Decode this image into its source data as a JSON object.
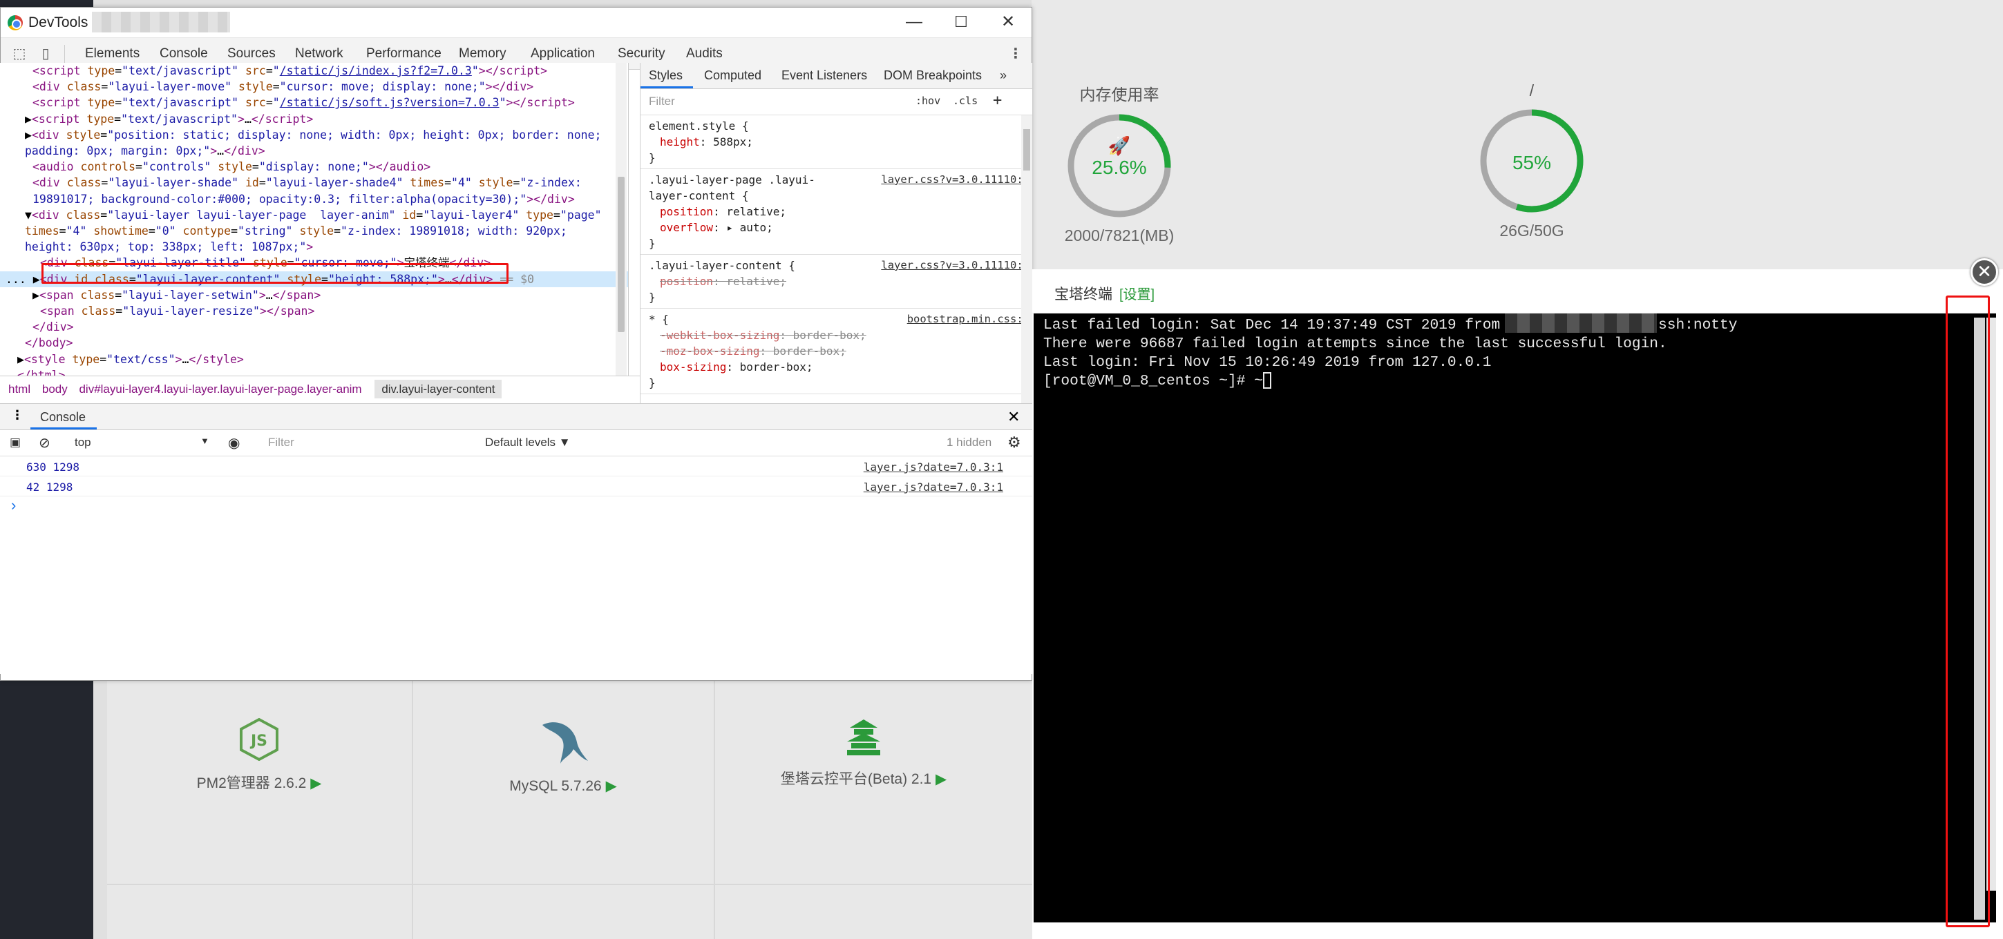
{
  "background": {
    "gauges": [
      {
        "title": "内存使用率",
        "value": "25.6%",
        "percent": 25.6,
        "sub": "2000/7821(MB)",
        "color": "#20a53a"
      },
      {
        "title": "/",
        "value": "55%",
        "percent": 55,
        "sub": "26G/50G",
        "color": "#20a53a"
      }
    ],
    "software": [
      {
        "label": "PM2管理器 2.6.2",
        "icon": "nodejs-icon"
      },
      {
        "label": "MySQL 5.7.26",
        "icon": "mysql-dolphin-icon"
      },
      {
        "label": "堡塔云控平台(Beta) 2.1",
        "icon": "pagoda-icon"
      }
    ]
  },
  "devtools": {
    "title": "DevTools",
    "window_buttons": {
      "minimize": "—",
      "maximize": "☐",
      "close": "✕"
    },
    "tabs": [
      "Elements",
      "Console",
      "Sources",
      "Network",
      "Performance",
      "Memory",
      "Application",
      "Security",
      "Audits"
    ],
    "active_tab": "Elements",
    "elements_lines": [
      {
        "indent": 3,
        "html": "<span class='tg'>&lt;script</span> <span class='at'>type</span>=<span class='av'>\"text/javascript\"</span> <span class='at'>src</span>=<span class='av'>\"<span class='lk'>/static/js/index.js?f2=7.0.3</span>\"</span><span class='tg'>&gt;&lt;/script&gt;</span>"
      },
      {
        "indent": 3,
        "html": "<span class='tg'>&lt;div</span> <span class='at'>class</span>=<span class='av'>\"layui-layer-move\"</span> <span class='at'>style</span>=<span class='av'>\"cursor: move; display: none;\"</span><span class='tg'>&gt;&lt;/div&gt;</span>"
      },
      {
        "indent": 3,
        "html": "<span class='tg'>&lt;script</span> <span class='at'>type</span>=<span class='av'>\"text/javascript\"</span> <span class='at'>src</span>=<span class='av'>\"<span class='lk'>/static/js/soft.js?version=7.0.3</span>\"</span><span class='tg'>&gt;&lt;/script&gt;</span>"
      },
      {
        "indent": 2,
        "html": "▶<span class='tg'>&lt;script</span> <span class='at'>type</span>=<span class='av'>\"text/javascript\"</span><span class='tg'>&gt;</span>…<span class='tg'>&lt;/script&gt;</span>"
      },
      {
        "indent": 2,
        "html": "▶<span class='tg'>&lt;div</span> <span class='at'>style</span>=<span class='av'>\"position: static; display: none; width: 0px; height: 0px; border: none;</span>"
      },
      {
        "indent": 2,
        "html": "<span class='av'>padding: 0px; margin: 0px;\"</span><span class='tg'>&gt;</span>…<span class='tg'>&lt;/div&gt;</span>"
      },
      {
        "indent": 3,
        "html": "<span class='tg'>&lt;audio</span> <span class='at'>controls</span>=<span class='av'>\"controls\"</span> <span class='at'>style</span>=<span class='av'>\"display: none;\"</span><span class='tg'>&gt;&lt;/audio&gt;</span>"
      },
      {
        "indent": 3,
        "html": "<span class='tg'>&lt;div</span> <span class='at'>class</span>=<span class='av'>\"layui-layer-shade\"</span> <span class='at'>id</span>=<span class='av'>\"layui-layer-shade4\"</span> <span class='at'>times</span>=<span class='av'>\"4\"</span> <span class='at'>style</span>=<span class='av'>\"z-index:</span>"
      },
      {
        "indent": 3,
        "html": "<span class='av'>19891017; background-color:#000; opacity:0.3; filter:alpha(opacity=30);\"</span><span class='tg'>&gt;&lt;/div&gt;</span>"
      },
      {
        "indent": 2,
        "html": "▼<span class='tg'>&lt;div</span> <span class='at'>class</span>=<span class='av'>\"layui-layer layui-layer-page  layer-anim\"</span> <span class='at'>id</span>=<span class='av'>\"layui-layer4\"</span> <span class='at'>type</span>=<span class='av'>\"page\"</span>"
      },
      {
        "indent": 2,
        "html": "<span class='at'>times</span>=<span class='av'>\"4\"</span> <span class='at'>showtime</span>=<span class='av'>\"0\"</span> <span class='at'>contype</span>=<span class='av'>\"string\"</span> <span class='at'>style</span>=<span class='av'>\"z-index: 19891018; width: 920px;</span>"
      },
      {
        "indent": 2,
        "html": "<span class='av'>height: 630px; top: 338px; left: 1087px;\"</span><span class='tg'>&gt;</span>"
      },
      {
        "indent": 4,
        "html": "<span class='tg'>&lt;div</span> <span class='at'>class</span>=<span class='av'>\"layui-layer-title\"</span> <span class='at'>style</span>=<span class='av'>\"cursor: move;\"</span><span class='tg'>&gt;</span><span class='tx'>宝塔终端</span><span class='tg'>&lt;/div&gt;</span>"
      },
      {
        "indent": 0,
        "sel": true,
        "html": "... ▶<span class='tg'>&lt;div</span> <span class='at'>id</span> <span class='at'>class</span>=<span class='av'>\"layui-layer-content\"</span> <span class='at'>style</span>=<span class='av'>\"height: 588px;\"</span><span class='tg'>&gt;</span>…<span class='tg'>&lt;/div&gt;</span> <span style='color:#888'>== $0</span>"
      },
      {
        "indent": 3,
        "html": "▶<span class='tg'>&lt;span</span> <span class='at'>class</span>=<span class='av'>\"layui-layer-setwin\"</span><span class='tg'>&gt;</span>…<span class='tg'>&lt;/span&gt;</span>"
      },
      {
        "indent": 4,
        "html": "<span class='tg'>&lt;span</span> <span class='at'>class</span>=<span class='av'>\"layui-layer-resize\"</span><span class='tg'>&gt;&lt;/span&gt;</span>"
      },
      {
        "indent": 3,
        "html": "<span class='tg'>&lt;/div&gt;</span>"
      },
      {
        "indent": 2,
        "html": "<span class='tg'>&lt;/body&gt;</span>"
      },
      {
        "indent": 1,
        "html": "▶<span class='tg'>&lt;style</span> <span class='at'>type</span>=<span class='av'>\"text/css\"</span><span class='tg'>&gt;</span>…<span class='tg'>&lt;/style&gt;</span>"
      },
      {
        "indent": 1,
        "html": "<span class='tg'>&lt;/html&gt;</span>"
      }
    ],
    "breadcrumbs": [
      "html",
      "body",
      "div#layui-layer4.layui-layer.layui-layer-page.layer-anim",
      "div.layui-layer-content"
    ],
    "styles_tabs": [
      "Styles",
      "Computed",
      "Event Listeners",
      "DOM Breakpoints",
      "»"
    ],
    "styles_filter_placeholder": "Filter",
    "styles_hov": ":hov",
    "styles_cls": ".cls",
    "style_rules": [
      {
        "selector": "element.style {",
        "source": "",
        "props": [
          {
            "n": "height",
            "v": "588px;",
            "strike": false
          }
        ]
      },
      {
        "selector": ".layui-layer-page .layui-\nlayer-content {",
        "source": "layer.css?v=3.0.11110:1",
        "props": [
          {
            "n": "position",
            "v": "relative;",
            "strike": false
          },
          {
            "n": "overflow",
            "v": "▸ auto;",
            "strike": false
          }
        ]
      },
      {
        "selector": ".layui-layer-content {",
        "source": "layer.css?v=3.0.11110:1",
        "props": [
          {
            "n": "position",
            "v": "relative;",
            "strike": true
          }
        ]
      },
      {
        "selector": "* {",
        "source": "bootstrap.min.css:5",
        "props": [
          {
            "n": "-webkit-box-sizing",
            "v": "border-box;",
            "strike": true
          },
          {
            "n": "-moz-box-sizing",
            "v": "border-box;",
            "strike": true
          },
          {
            "n": "box-sizing",
            "v": "border-box;",
            "strike": false
          }
        ]
      }
    ],
    "console": {
      "title": "Console",
      "context": "top",
      "filter_placeholder": "Filter",
      "levels": "Default levels ▼",
      "hidden": "1 hidden",
      "messages": [
        {
          "text": "630 1298",
          "source": "layer.js?date=7.0.3:1"
        },
        {
          "text": "42 1298",
          "source": "layer.js?date=7.0.3:1"
        }
      ],
      "prompt": "›"
    }
  },
  "terminal": {
    "title": "宝塔终端",
    "settings": "[设置]",
    "lines": [
      "Last failed login: Sat Dec 14 19:37:49 CST 2019 from               on ssh:notty",
      "There were 96687 failed login attempts since the last successful login.",
      "Last login: Fri Nov 15 10:26:49 2019 from 127.0.0.1",
      "[root@VM_0_8_centos ~]# ~"
    ],
    "close": "✕"
  }
}
